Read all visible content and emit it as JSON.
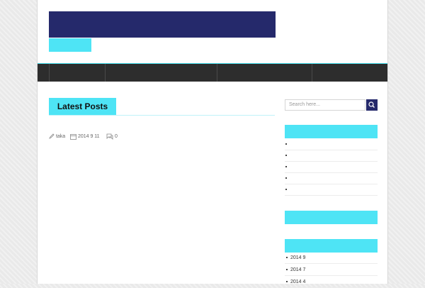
{
  "site": {
    "title": "",
    "tagline": ""
  },
  "nav": {
    "items": [
      {
        "label": ""
      },
      {
        "label": ""
      },
      {
        "label": ""
      }
    ]
  },
  "main": {
    "section_title": "Latest Posts",
    "post_meta": {
      "author": "taka",
      "date": "2014 9 11",
      "comments": "0"
    }
  },
  "sidebar": {
    "search_placeholder": "Search here...",
    "archive_items": [
      "2014 9",
      "2014 7",
      "2014 4"
    ]
  },
  "colors": {
    "accent": "#4ee4f5",
    "brand": "#25296b",
    "nav_bg": "#2d2d2d"
  }
}
